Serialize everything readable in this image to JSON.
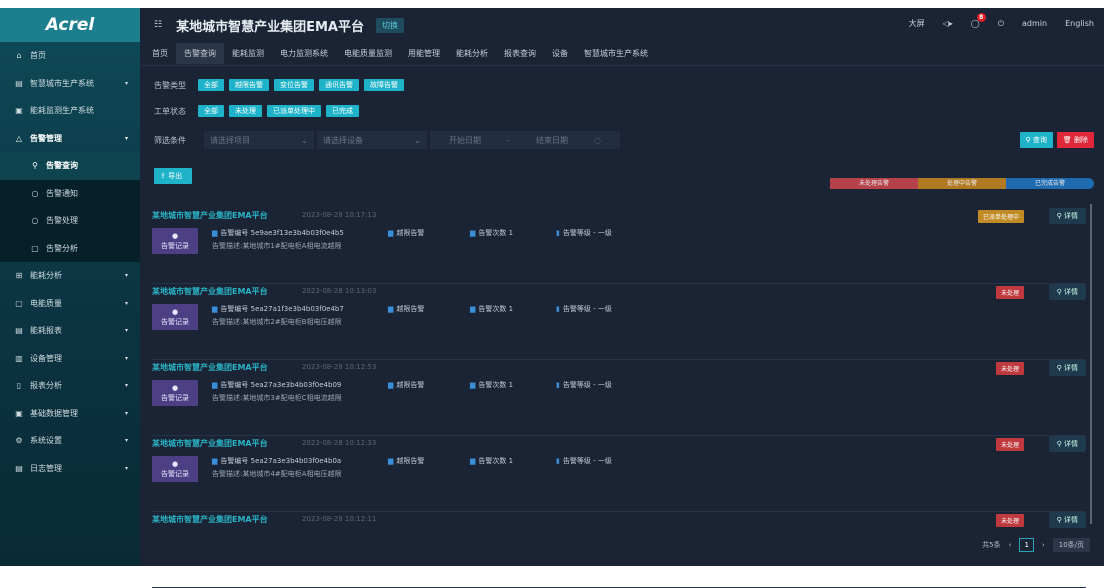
{
  "logo": "Acrel",
  "header": {
    "title": "某地城市智慧产业集团EMA平台",
    "badge": "切换",
    "actions": [
      "大屏",
      "消息",
      "告警",
      "退出",
      "admin",
      "English"
    ],
    "alarm_count": "8"
  },
  "sidebar": {
    "items": [
      {
        "label": "首页",
        "icon": "⌂"
      },
      {
        "label": "智慧城市生产系统",
        "icon": "▤",
        "chevron": true
      },
      {
        "label": "能耗监测生产系统",
        "icon": "▣"
      },
      {
        "label": "告警管理",
        "icon": "△",
        "chevron": true,
        "open": true
      },
      {
        "label": "告警查询",
        "icon": "⚲",
        "sub": true,
        "active": true
      },
      {
        "label": "告警通知",
        "icon": "○",
        "sub": true
      },
      {
        "label": "告警处理",
        "icon": "○",
        "sub": true
      },
      {
        "label": "告警分析",
        "icon": "▢",
        "sub": true
      },
      {
        "label": "能耗分析",
        "icon": "⊞",
        "chevron": true
      },
      {
        "label": "电能质量",
        "icon": "▢",
        "chevron": true
      },
      {
        "label": "能耗报表",
        "icon": "▤",
        "chevron": true
      },
      {
        "label": "设备管理",
        "icon": "▥",
        "chevron": true
      },
      {
        "label": "报表分析",
        "icon": "▯",
        "chevron": true
      },
      {
        "label": "基础数据管理",
        "icon": "▣",
        "chevron": true
      },
      {
        "label": "系统设置",
        "icon": "⚙",
        "chevron": true
      },
      {
        "label": "日志管理",
        "icon": "▤",
        "chevron": true
      }
    ]
  },
  "tabs": [
    "首页",
    "告警查询",
    "能耗监测",
    "电力监测系统",
    "电能质量监测",
    "用能管理",
    "能耗分析",
    "报表查询",
    "设备",
    "智慧城市生产系统"
  ],
  "filters": {
    "type_label": "告警类型",
    "types": [
      "全部",
      "越限告警",
      "变位告警",
      "通讯告警",
      "故障告警"
    ],
    "status_label": "工单状态",
    "statuses": [
      "全部",
      "未处理",
      "已派单处理中",
      "已完成"
    ],
    "cond_label": "筛选条件",
    "project_placeholder": "请选择项目",
    "device_placeholder": "请选择设备",
    "start_date": "开始日期",
    "end_date": "结束日期",
    "query": "查询",
    "delete": "删除",
    "export": "导出"
  },
  "legend": [
    "未处理告警",
    "处理中告警",
    "已完成告警"
  ],
  "legend_colors": [
    "#b5414a",
    "#b07a22",
    "#1f6bb0"
  ],
  "cards": [
    {
      "title": "某地城市智慧产业集团EMA平台",
      "time": "2023-08-28 10:17:13",
      "thumb": "告警记录",
      "code": "告警编号 5e9ae3f13e3b4b03f0e4b5",
      "type": "越限告警",
      "count_label": "告警次数",
      "count": "1",
      "level_label": "告警等级",
      "level": "一级",
      "desc": "告警描述:某地城市1#配电柜A相电流越限",
      "status": "已派单处理中",
      "status_color": "#c08a24",
      "detail": "详情"
    },
    {
      "title": "某地城市智慧产业集团EMA平台",
      "time": "2023-08-28 10:13:03",
      "thumb": "告警记录",
      "code": "告警编号 5ea27a1f3e3b4b03f0e4b7",
      "type": "越限告警",
      "count_label": "告警次数",
      "count": "1",
      "level_label": "告警等级",
      "level": "一级",
      "desc": "告警描述:某地城市2#配电柜B相电压越限",
      "status": "未处理",
      "status_color": "#c0393f",
      "detail": "详情"
    },
    {
      "title": "某地城市智慧产业集团EMA平台",
      "time": "2023-08-28 10:12:53",
      "thumb": "告警记录",
      "code": "告警编号 5ea27a3e3b4b03f0e4b09",
      "type": "越限告警",
      "count_label": "告警次数",
      "count": "1",
      "level_label": "告警等级",
      "level": "一级",
      "desc": "告警描述:某地城市3#配电柜C相电流越限",
      "status": "未处理",
      "status_color": "#c0393f",
      "detail": "详情"
    },
    {
      "title": "某地城市智慧产业集团EMA平台",
      "time": "2023-08-28 10:12:33",
      "thumb": "告警记录",
      "code": "告警编号 5ea27a3e3b4b03f0e4b0a",
      "type": "越限告警",
      "count_label": "告警次数",
      "count": "1",
      "level_label": "告警等级",
      "level": "一级",
      "desc": "告警描述:某地城市4#配电柜A相电压越限",
      "status": "未处理",
      "status_color": "#c0393f",
      "detail": "详情"
    },
    {
      "title": "某地城市智慧产业集团EMA平台",
      "time": "2023-08-28 10:12:11",
      "status": "未处理",
      "status_color": "#c0393f",
      "detail": "详情"
    }
  ],
  "pagination": {
    "total": "共5条",
    "page": "1",
    "goto": "10条/页"
  }
}
